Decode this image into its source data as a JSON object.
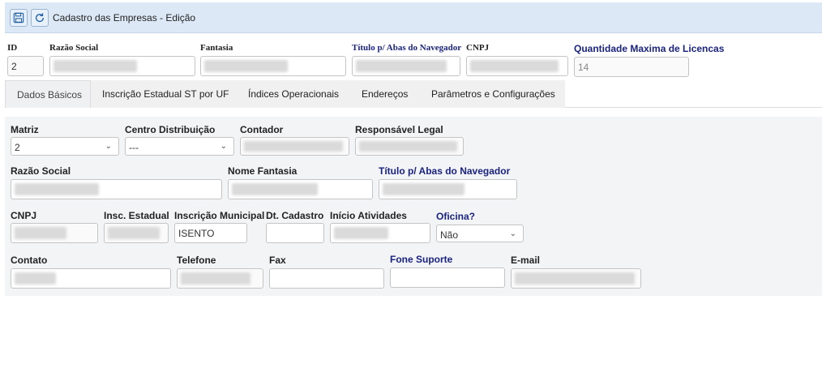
{
  "header": {
    "title": "Cadastro das Empresas - Edição",
    "save_icon": "save-icon",
    "refresh_icon": "refresh-icon"
  },
  "top": {
    "id_label": "ID",
    "id_value": "2",
    "razao_label": "Razão Social",
    "fantasia_label": "Fantasia",
    "titulo_label": "Título p/ Abas do Navegador",
    "cnpj_label": "CNPJ",
    "qtd_label": "Quantidade Maxima de Licencas",
    "qtd_value": "14"
  },
  "tabs": [
    {
      "label": "Dados Básicos"
    },
    {
      "label": "Inscrição Estadual ST por UF"
    },
    {
      "label": "Índices Operacionais"
    },
    {
      "label": "Endereços"
    },
    {
      "label": "Parâmetros e Configurações"
    }
  ],
  "form": {
    "matriz_label": "Matriz",
    "matriz_value": "2",
    "centro_label": "Centro Distribuição",
    "centro_value": "---",
    "contador_label": "Contador",
    "responsavel_label": "Responsável Legal",
    "razao_label": "Razão Social",
    "nome_fantasia_label": "Nome Fantasia",
    "titulo_label": "Título p/ Abas do Navegador",
    "cnpj_label": "CNPJ",
    "insc_estadual_label": "Insc. Estadual",
    "insc_municipal_label": "Inscrição Municipal",
    "insc_municipal_value": "ISENTO",
    "dt_cadastro_label": "Dt. Cadastro",
    "inicio_label": "Início Atividades",
    "oficina_label": "Oficina?",
    "oficina_value": "Não",
    "contato_label": "Contato",
    "telefone_label": "Telefone",
    "fax_label": "Fax",
    "fone_suporte_label": "Fone Suporte",
    "email_label": "E-mail"
  },
  "colors": {
    "header_bg": "#dce8f5",
    "label_blue": "#1a237e",
    "panel_bg": "#f2f4f6"
  }
}
